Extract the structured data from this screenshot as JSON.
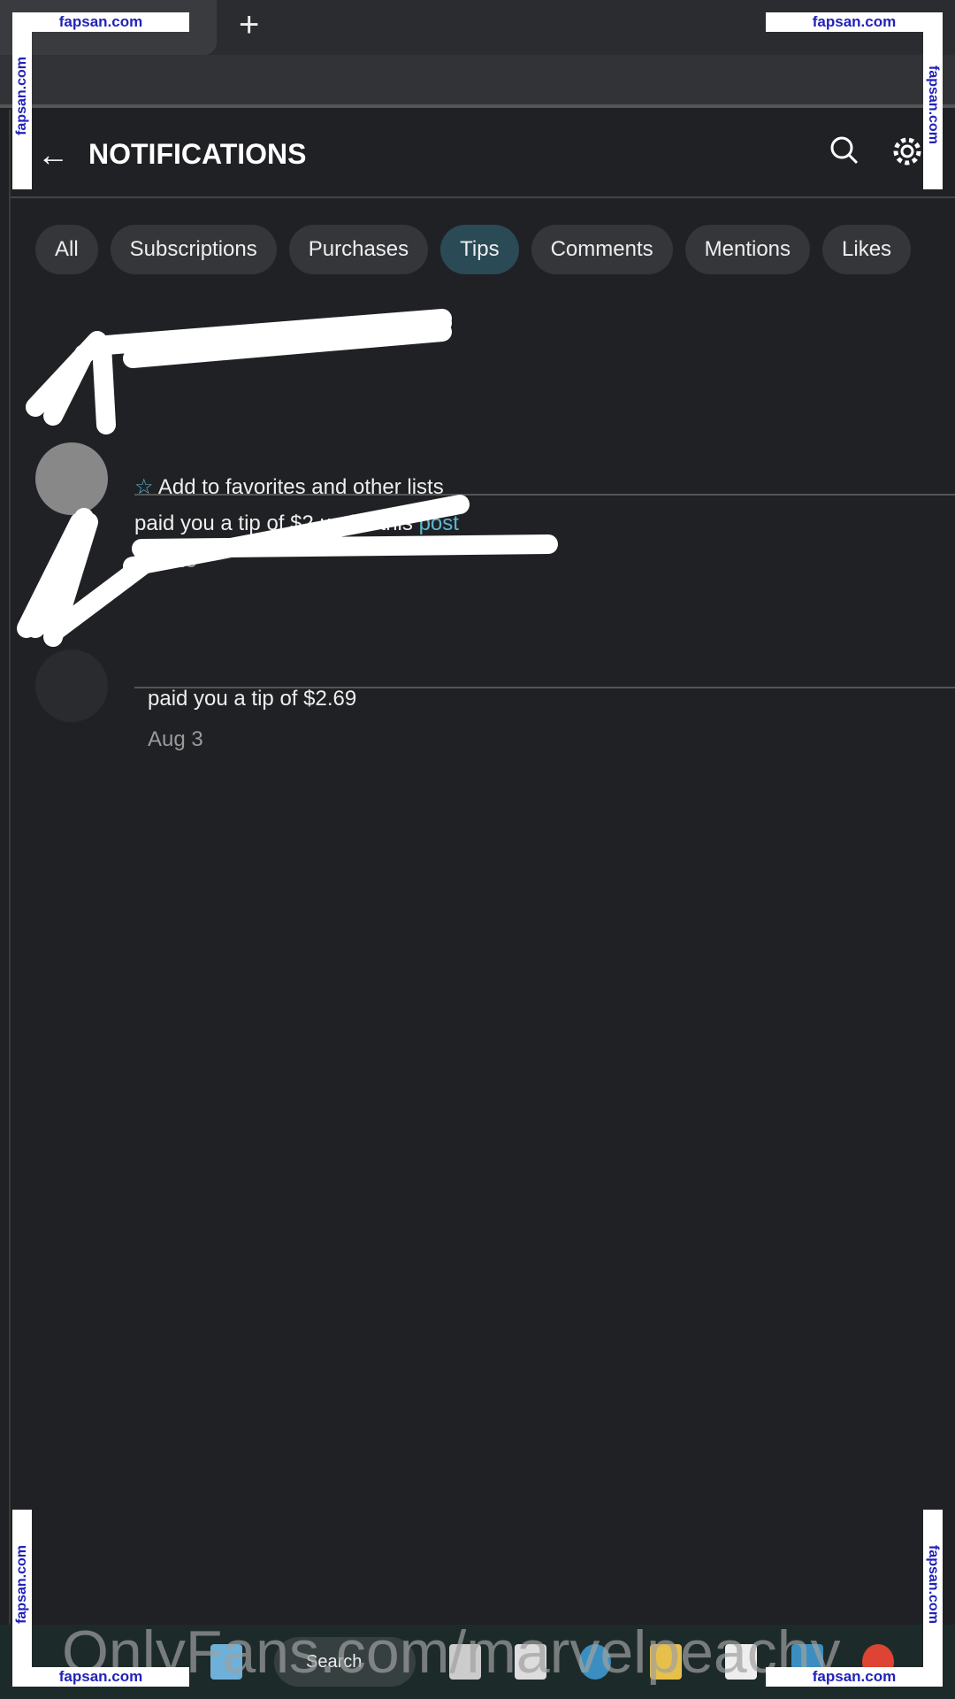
{
  "browser": {
    "new_tab": "+",
    "tab_close": "×"
  },
  "header": {
    "title": "NOTIFICATIONS",
    "back_icon": "arrow-left-icon",
    "search_icon": "search-icon",
    "settings_icon": "gear-icon"
  },
  "filters": [
    {
      "label": "All",
      "active": false
    },
    {
      "label": "Subscriptions",
      "active": false
    },
    {
      "label": "Purchases",
      "active": false
    },
    {
      "label": "Tips",
      "active": true
    },
    {
      "label": "Comments",
      "active": false
    },
    {
      "label": "Mentions",
      "active": false
    },
    {
      "label": "Likes",
      "active": false
    }
  ],
  "notifications": [
    {
      "favorites": "Add to favorites and other lists",
      "message": "paid you a tip of $2 under this ",
      "link": "post",
      "date": "Oct 25"
    },
    {
      "message": "paid you a tip of $2.69",
      "date": "Aug 3"
    }
  ],
  "taskbar": {
    "search": "Search"
  },
  "watermark": "OnlyFans.com/marvelpeachy",
  "stamp": "fapsan.com",
  "colors": {
    "accent": "#5bb7d0",
    "active_pill": "#2a4a55",
    "background": "#202124"
  }
}
